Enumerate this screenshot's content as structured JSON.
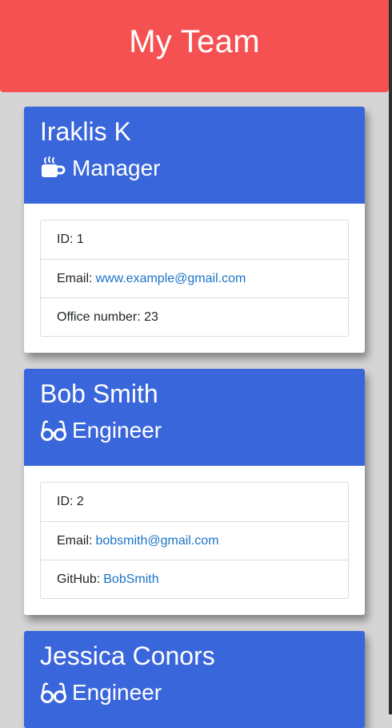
{
  "header": {
    "title": "My Team"
  },
  "team": [
    {
      "name": "Iraklis K",
      "role": "Manager",
      "role_icon": "mug-icon",
      "details": {
        "id_label": "ID:",
        "id": "1",
        "email_label": "Email:",
        "email": "www.example@gmail.com",
        "extra_label": "Office number:",
        "extra": "23"
      }
    },
    {
      "name": "Bob Smith",
      "role": "Engineer",
      "role_icon": "glasses-icon",
      "details": {
        "id_label": "ID:",
        "id": "2",
        "email_label": "Email:",
        "email": "bobsmith@gmail.com",
        "extra_label": "GitHub:",
        "extra": "BobSmith"
      }
    },
    {
      "name": "Jessica Conors",
      "role": "Engineer",
      "role_icon": "glasses-icon"
    }
  ],
  "colors": {
    "header_bg": "#f65152",
    "card_header_bg": "#3a66db",
    "link": "#1a73c7",
    "page_bg": "#d5d5d5"
  }
}
